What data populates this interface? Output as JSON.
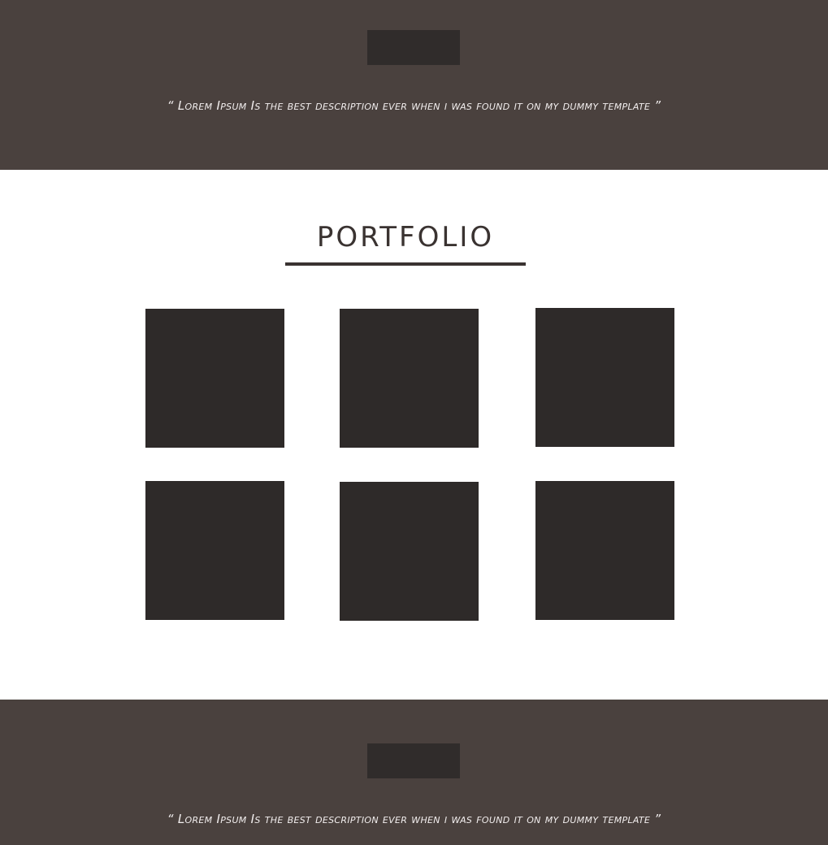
{
  "top_band": {
    "quote": "“ Lorem Ipsum Is the best description ever when i was found it on my dummy template ”"
  },
  "portfolio": {
    "title": "PORTFOLIO",
    "tile_count": 6
  },
  "bottom_band": {
    "quote": "“ Lorem Ipsum Is the best description ever when i was found it on my dummy template ”"
  },
  "colors": {
    "band_background": "#4a413e",
    "band_block": "#302c2b",
    "tile": "#2e2a29",
    "title_text": "#3a3331",
    "quote_text": "#f2eeee"
  }
}
